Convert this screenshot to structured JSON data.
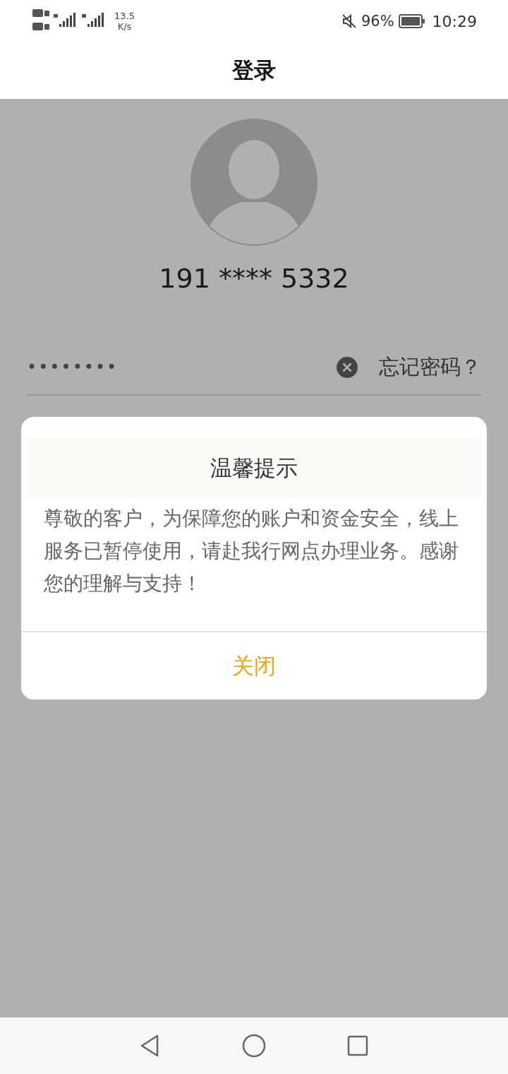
{
  "status_bar": {
    "net_speed": "13.5",
    "net_speed_unit": "K/s",
    "battery": "96%",
    "time": "10:29"
  },
  "header": {
    "title": "登录"
  },
  "account": {
    "phone": "191 **** 5332"
  },
  "password": {
    "value": "••••••••",
    "forgot_link": "忘记密码？"
  },
  "dialog": {
    "title": "温馨提示",
    "message": "尊敬的客户，为保障您的账户和资金安全，线上服务已暂停使用，请赴我行网点办理业务。感谢您的理解与支持！",
    "button": "关闭"
  }
}
